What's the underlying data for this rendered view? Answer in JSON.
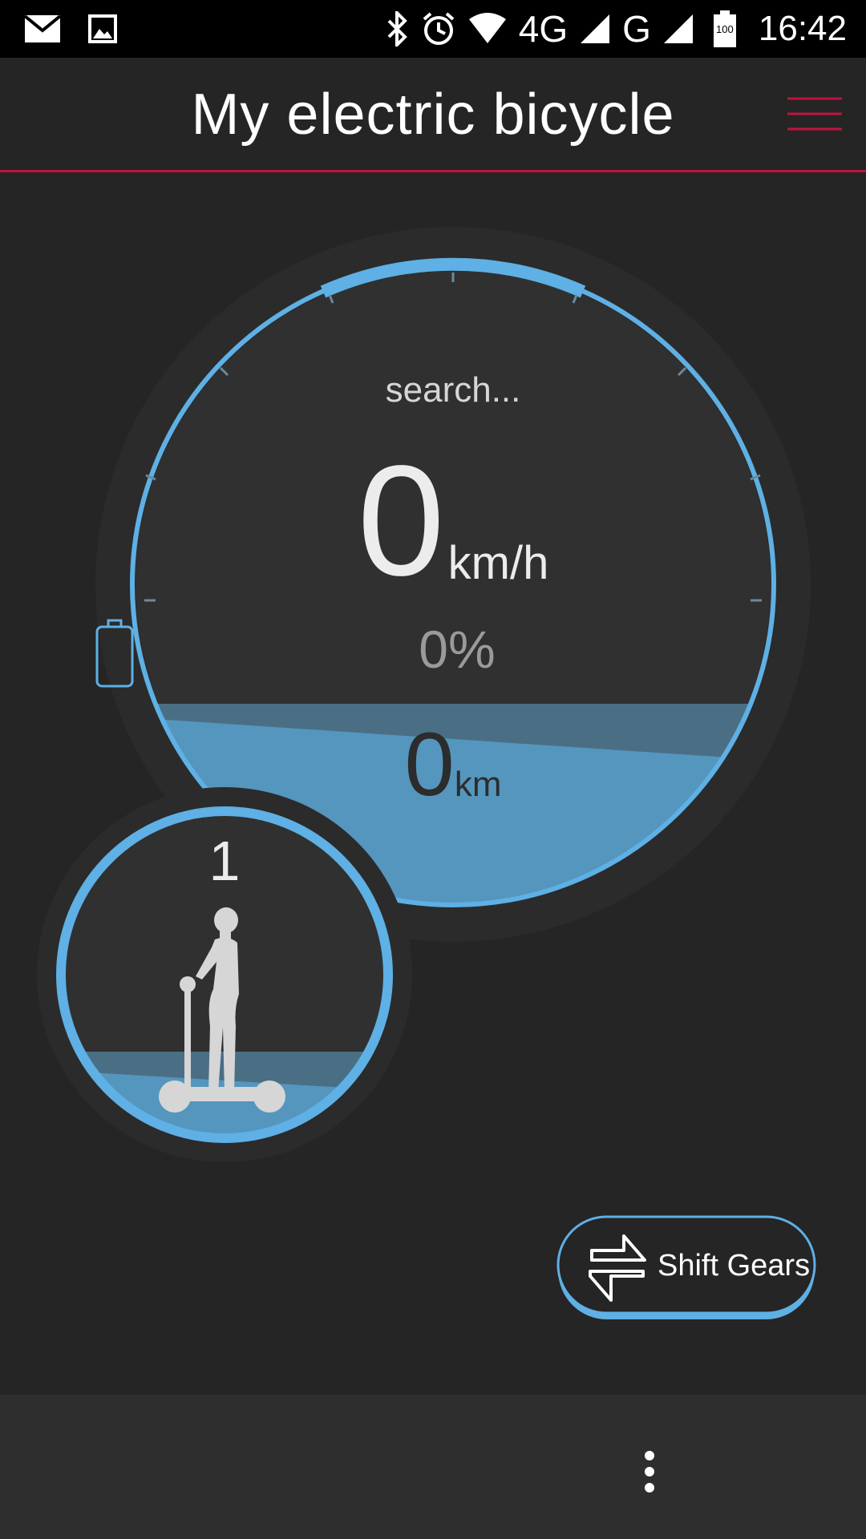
{
  "status_bar": {
    "icons": [
      "mail-icon",
      "gallery-icon",
      "bluetooth-icon",
      "alarm-icon",
      "wifi-icon",
      "signal-4g-icon",
      "signal-g-icon",
      "battery-icon"
    ],
    "network_1": "4G",
    "network_2": "G",
    "battery_level": "100",
    "time": "16:42"
  },
  "header": {
    "title": "My electric bicycle",
    "menu_icon": "hamburger-menu-icon",
    "accent_color": "#c2113f"
  },
  "gauge": {
    "status": "search...",
    "speed": "0",
    "speed_unit": "km/h",
    "battery_percent": "0%",
    "distance": "0",
    "distance_unit": "km",
    "ring_color": "#5eb0e5",
    "fill_color": "#5596be"
  },
  "gear": {
    "number": "1",
    "rider_icon": "segway-rider-icon"
  },
  "shift_button": {
    "label": "Shift Gears",
    "icon": "swap-arrows-icon"
  },
  "bottom_bar": {
    "overflow_icon": "more-vertical-icon"
  }
}
